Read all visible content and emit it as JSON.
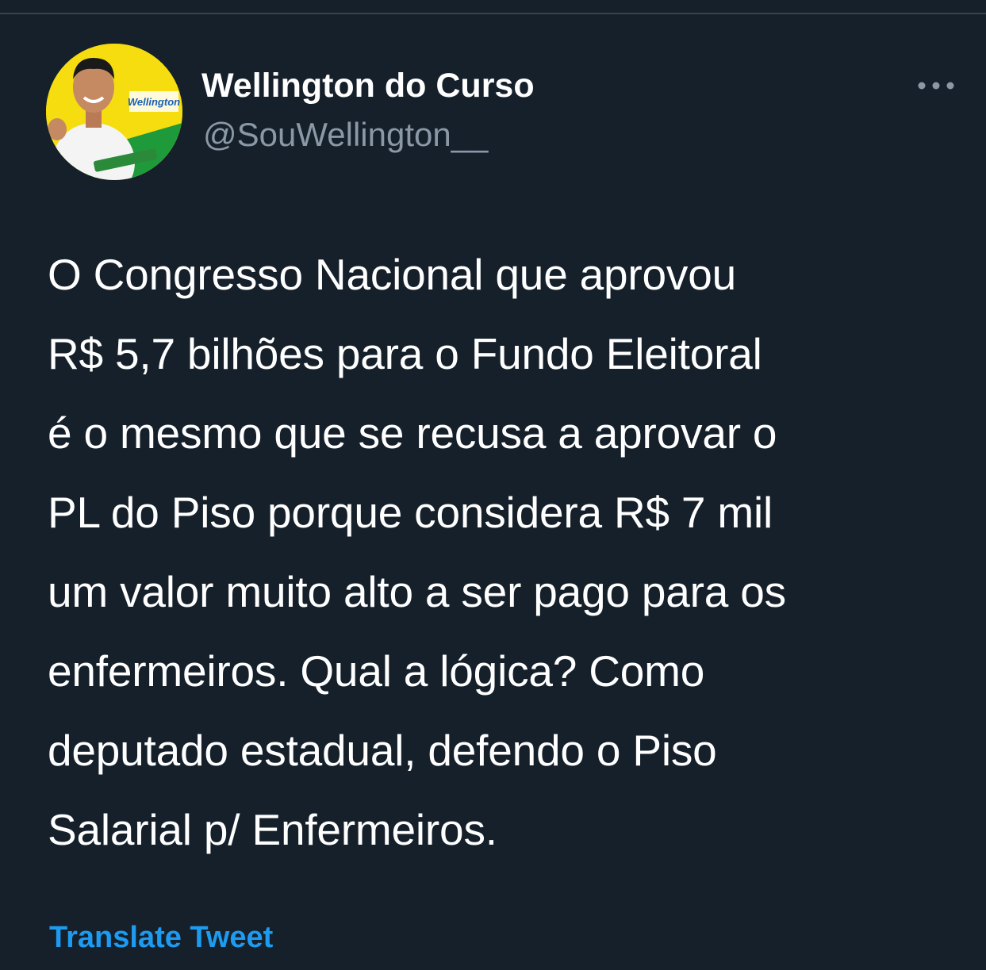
{
  "tweet": {
    "author": {
      "display_name": "Wellington do Curso",
      "handle": "@SouWellington__",
      "avatar_text": "Wellington"
    },
    "more_icon": "ellipsis-icon",
    "text_lines": [
      "O Congresso Nacional que aprovou",
      "R$ 5,7 bilhões para o Fundo Eleitoral",
      "é o mesmo que se recusa a aprovar o",
      "PL do Piso porque considera R$ 7 mil",
      "um valor muito alto a ser pago para os",
      "enfermeiros. Qual a lógica? Como",
      "deputado estadual, defendo o Piso",
      "Salarial p/ Enfermeiros."
    ],
    "translate_label": "Translate Tweet"
  },
  "colors": {
    "background": "#15202b",
    "secondary_text": "#8b98a5",
    "link": "#1d9bf0",
    "avatar_yellow": "#f5dd10"
  }
}
